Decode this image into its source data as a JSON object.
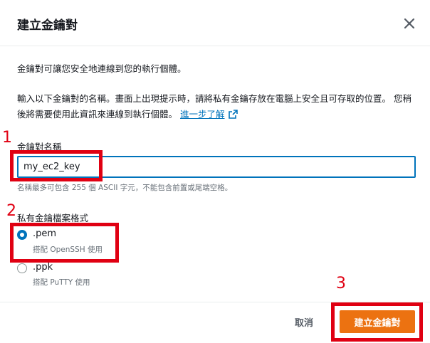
{
  "dialog": {
    "title": "建立金鑰對",
    "intro": "金鑰對可讓您安全地連線到您的執行個體。",
    "instructions": "輸入以下金鑰對的名稱。畫面上出現提示時，請將私有金鑰存放在電腦上安全且可存取的位置。 您稍後將需要使用此資訊來連線到執行個體。",
    "learn_more": "進一步了解"
  },
  "form": {
    "name_label": "金鑰對名稱",
    "name_value": "my_ec2_key",
    "name_hint": "名稱最多可包含 255 個 ASCII 字元，不能包含前置或尾端空格。",
    "format_label": "私有金鑰檔案格式",
    "options": [
      {
        "label": ".pem",
        "desc": "搭配 OpenSSH 使用",
        "selected": true
      },
      {
        "label": ".ppk",
        "desc": "搭配 PuTTY 使用",
        "selected": false
      }
    ]
  },
  "footer": {
    "cancel_label": "取消",
    "create_label": "建立金鑰對"
  },
  "annotations": [
    "1",
    "2",
    "3"
  ],
  "colors": {
    "accent": "#0073bb",
    "primary_button": "#ec7211",
    "annotation": "#e00012"
  },
  "icons": [
    "close-icon",
    "external-link-icon"
  ]
}
